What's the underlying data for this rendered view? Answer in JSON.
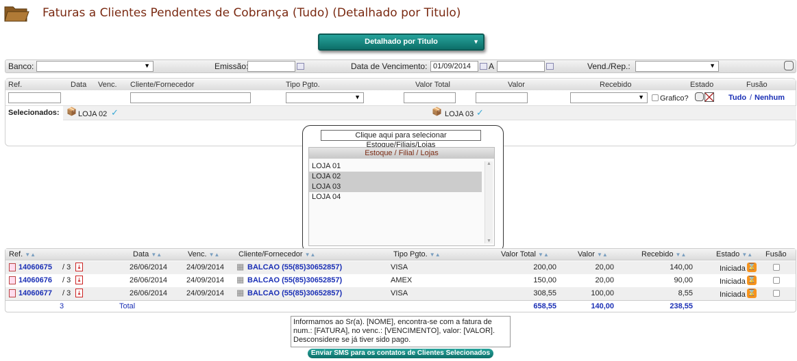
{
  "page": {
    "title": "Faturas a Clientes Pendentes de Cobrança (Tudo) (Detalhado por Titulo)",
    "mode_button": "Detalhado por Titulo"
  },
  "filters": {
    "banco_label": "Banco:",
    "banco_value": "",
    "emissao_label": "Emissão:",
    "emissao_value": "",
    "vencimento_label": "Data de Vencimento:",
    "vencimento_from": "01/09/2014",
    "vencimento_to_label": "A",
    "vencimento_to": "",
    "vend_label": "Vend./Rep.:",
    "vend_value": ""
  },
  "search": {
    "headers": {
      "ref": "Ref.",
      "data": "Data",
      "venc": "Venc.",
      "cliente": "Cliente/Fornecedor",
      "tipo": "Tipo Pgto.",
      "valor_total": "Valor Total",
      "valor": "Valor",
      "recebido": "Recebido",
      "estado": "Estado",
      "fusao": "Fusão"
    },
    "grafico_label": "Grafico?",
    "tudo": "Tudo",
    "sep": "/",
    "nenhum": "Nenhum",
    "selecionados_label": "Selecionados:",
    "selected": [
      "LOJA 02",
      "LOJA 03"
    ]
  },
  "popup": {
    "button": "Clique aqui para selecionar Estoque/Filiais/Lojas",
    "list_title": "Estoque / Filial / Lojas",
    "options": [
      {
        "label": "LOJA 01",
        "selected": false
      },
      {
        "label": "LOJA 02",
        "selected": true
      },
      {
        "label": "LOJA 03",
        "selected": true
      },
      {
        "label": "LOJA 04",
        "selected": false
      }
    ]
  },
  "table": {
    "headers": {
      "ref": "Ref.",
      "data": "Data",
      "venc": "Venc.",
      "cliente": "Cliente/Fornecedor",
      "tipo": "Tipo Pgto.",
      "valor_total": "Valor Total",
      "valor": "Valor",
      "recebido": "Recebido",
      "estado": "Estado",
      "fusao": "Fusão"
    },
    "rows": [
      {
        "ref": "14060675",
        "parc": "/ 3",
        "data": "26/06/2014",
        "venc": "24/09/2014",
        "cliente": "BALCAO (55(85)30652857)",
        "tipo": "VISA",
        "valor_total": "200,00",
        "valor": "20,00",
        "recebido": "140,00",
        "estado": "Iniciada"
      },
      {
        "ref": "14060676",
        "parc": "/ 3",
        "data": "26/06/2014",
        "venc": "24/09/2014",
        "cliente": "BALCAO (55(85)30652857)",
        "tipo": "AMEX",
        "valor_total": "150,00",
        "valor": "20,00",
        "recebido": "90,00",
        "estado": "Iniciada"
      },
      {
        "ref": "14060677",
        "parc": "/ 3",
        "data": "26/06/2014",
        "venc": "24/09/2014",
        "cliente": "BALCAO (55(85)30652857)",
        "tipo": "VISA",
        "valor_total": "308,55",
        "valor": "100,00",
        "recebido": "8,55",
        "estado": "Iniciada"
      }
    ],
    "totals": {
      "count": "3",
      "label": "Total",
      "valor_total": "658,55",
      "valor": "140,00",
      "recebido": "238,55"
    }
  },
  "sms": {
    "message": "Informamos ao Sr(a). [NOME], encontra-se com a fatura de num.: [FATURA], no venc.: [VENCIMENTO], valor: [VALOR]. Desconsidere se já tiver sido pago.",
    "button": "Enviar SMS para os contatos de Clientes Selecionados"
  }
}
